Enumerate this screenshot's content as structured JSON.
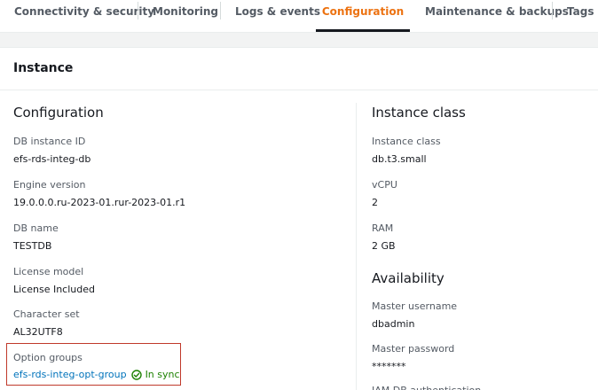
{
  "tabs": [
    {
      "label": "Connectivity & security"
    },
    {
      "label": "Monitoring"
    },
    {
      "label": "Logs & events"
    },
    {
      "label": "Configuration"
    },
    {
      "label": "Maintenance & backups"
    },
    {
      "label": "Tags"
    }
  ],
  "active_tab": "Configuration",
  "panel": {
    "title": "Instance"
  },
  "configuration": {
    "heading": "Configuration",
    "fields": [
      {
        "label": "DB instance ID",
        "value": "efs-rds-integ-db"
      },
      {
        "label": "Engine version",
        "value": "19.0.0.0.ru-2023-01.rur-2023-01.r1"
      },
      {
        "label": "DB name",
        "value": "TESTDB"
      },
      {
        "label": "License model",
        "value": "License Included"
      },
      {
        "label": "Character set",
        "value": "AL32UTF8"
      }
    ],
    "option_groups": {
      "label": "Option groups",
      "link": "efs-rds-integ-opt-group",
      "status": "In sync"
    }
  },
  "instance_class": {
    "heading": "Instance class",
    "fields": [
      {
        "label": "Instance class",
        "value": "db.t3.small"
      },
      {
        "label": "vCPU",
        "value": "2"
      },
      {
        "label": "RAM",
        "value": "2 GB"
      }
    ]
  },
  "availability": {
    "heading": "Availability",
    "fields": [
      {
        "label": "Master username",
        "value": "dbadmin"
      },
      {
        "label": "Master password",
        "value": "*******"
      }
    ],
    "cutoff_label": "IAM DB authentication"
  },
  "colors": {
    "accent": "#ec7211",
    "link": "#0073bb",
    "success": "#1d8102",
    "highlight": "#c0392b"
  }
}
